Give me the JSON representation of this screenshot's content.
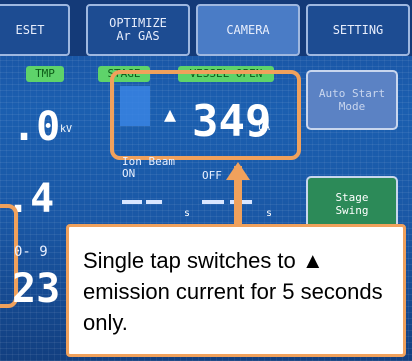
{
  "tabs": [
    {
      "id": "reset",
      "label": "ESET"
    },
    {
      "id": "optimize",
      "label": "OPTIMIZE\nAr GAS"
    },
    {
      "id": "camera",
      "label": "CAMERA"
    },
    {
      "id": "setting",
      "label": "SETTING"
    }
  ],
  "status_chips": {
    "tmp": "TMP",
    "stage": "STAGE",
    "vessel": "VESSEL OPEN"
  },
  "readouts": {
    "voltage_value": ".0",
    "voltage_unit": "kV",
    "current_arrow": "▲",
    "current_value": "349",
    "current_unit": "uA",
    "left_value_2": ".4",
    "left_value_3": "23",
    "left_small": "0- 9"
  },
  "ion_beam": {
    "label": "Ion Beam",
    "on": "ON",
    "off": "OFF",
    "sec_unit": "s"
  },
  "buttons": {
    "auto_start": "Auto Start\nMode",
    "stage_swing": "Stage\nSwing"
  },
  "annotation": {
    "text": "Single tap switches to ▲ emission current for 5 seconds only."
  },
  "colors": {
    "callout": "#f0a15c",
    "chip": "#5ed36a",
    "screen": "#1b5fb0"
  }
}
